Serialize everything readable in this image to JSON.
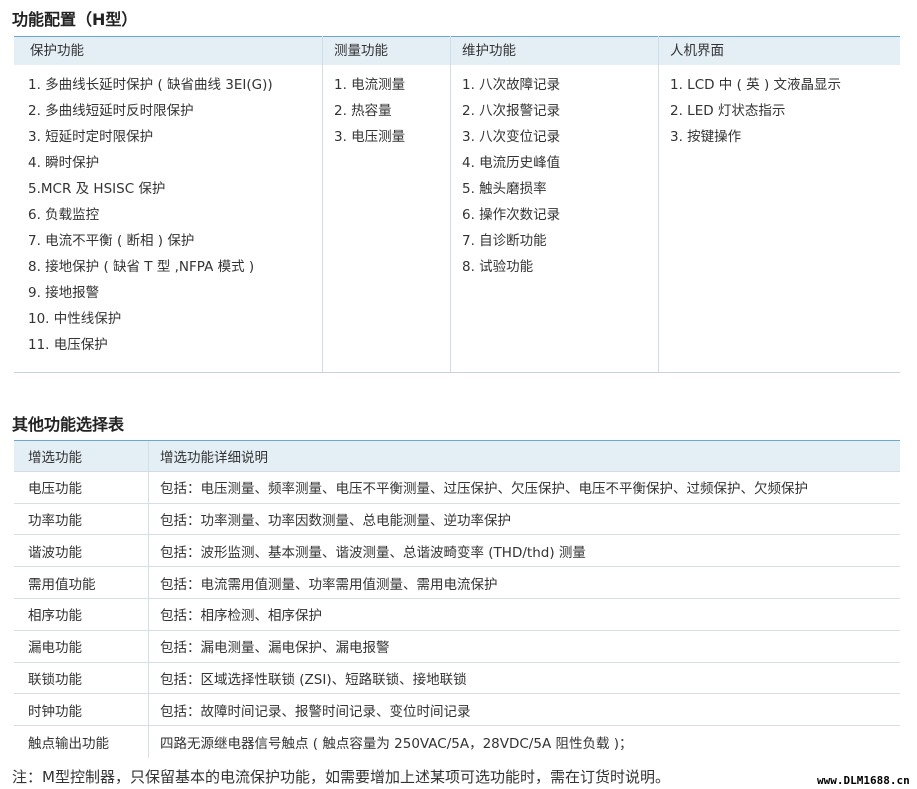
{
  "section1": {
    "title": "功能配置（H型）",
    "headers": [
      "保护功能",
      "测量功能",
      "维护功能",
      "人机界面"
    ],
    "protection": [
      "1. 多曲线长延时保护 ( 缺省曲线 3EI(G))",
      "2. 多曲线短延时反时限保护",
      "3. 短延时定时限保护",
      "4. 瞬时保护",
      "5.MCR 及 HSISC 保护",
      "6. 负载监控",
      "7. 电流不平衡 ( 断相 ) 保护",
      "8. 接地保护 ( 缺省 T 型 ,NFPA 模式 )",
      "9. 接地报警",
      "10. 中性线保护",
      "11. 电压保护"
    ],
    "measurement": [
      "1. 电流测量",
      "2. 热容量",
      "3. 电压测量"
    ],
    "maintenance": [
      "1. 八次故障记录",
      "2. 八次报警记录",
      "3. 八次变位记录",
      "4. 电流历史峰值",
      "5. 触头磨损率",
      "6. 操作次数记录",
      "7. 自诊断功能",
      "8. 试验功能"
    ],
    "hmi": [
      "1. LCD 中 ( 英 ) 文液晶显示",
      "2. LED 灯状态指示",
      "3. 按键操作"
    ]
  },
  "section2": {
    "title": "其他功能选择表",
    "headers": [
      "增选功能",
      "增选功能详细说明"
    ],
    "rows": [
      {
        "name": "电压功能",
        "desc": "包括：电压测量、频率测量、电压不平衡测量、过压保护、欠压保护、电压不平衡保护、过频保护、欠频保护"
      },
      {
        "name": "功率功能",
        "desc": "包括：功率测量、功率因数测量、总电能测量、逆功率保护"
      },
      {
        "name": "谐波功能",
        "desc": "包括：波形监测、基本测量、谐波测量、总谐波畸变率 (THD/thd) 测量"
      },
      {
        "name": "需用值功能",
        "desc": "包括：电流需用值测量、功率需用值测量、需用电流保护"
      },
      {
        "name": "相序功能",
        "desc": "包括：相序检测、相序保护"
      },
      {
        "name": "漏电功能",
        "desc": "包括：漏电测量、漏电保护、漏电报警"
      },
      {
        "name": "联锁功能",
        "desc": "包括：区域选择性联锁 (ZSI)、短路联锁、接地联锁"
      },
      {
        "name": "时钟功能",
        "desc": "包括：故障时间记录、报警时间记录、变位时间记录"
      },
      {
        "name": "触点输出功能",
        "desc": "四路无源继电器信号触点 ( 触点容量为 250VAC/5A，28VDC/5A  阻性负载 )；"
      }
    ]
  },
  "note": "注：M型控制器，只保留基本的电流保护功能，如需要增加上述某项可选功能时，需在订货时说明。",
  "watermark": "www.DLM1688.cn",
  "colors": {
    "header_bg": "#e4eef5",
    "header_border": "#6aa8d2",
    "grid": "#d6dfe6"
  }
}
